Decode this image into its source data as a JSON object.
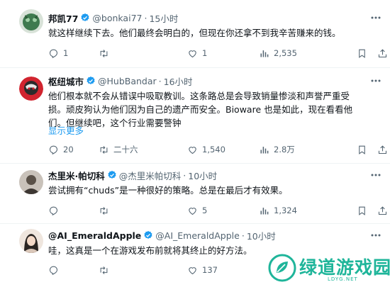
{
  "tweets": [
    {
      "name": "邦凯77",
      "handle": "@bonkai77",
      "time": "15小时",
      "text": [
        "就这样继续下去。他们最终会明白的，但现在你还拿不到我辛苦赚来的钱。"
      ],
      "show_more": "",
      "replies": "1",
      "retweets": "",
      "likes": "1",
      "views": "2,535",
      "avatar_color": "#3f7a4f"
    },
    {
      "name": "枢纽城市",
      "handle": "@HubBandar",
      "time": "16小时",
      "text": [
        "他们根本就不会从错误中吸取教训。这条路总是会导致销量惨淡和声誉严重受",
        "损。顽皮狗认为他们因为自己的遗产而安全。Bioware 也是如此，现在看看他",
        "们。但继续吧，这个行业需要警钟"
      ],
      "show_more": "显示更多",
      "replies": "20",
      "retweets": "二十六",
      "likes": "1,540",
      "views": "2.8万",
      "avatar_color": "#d1242f"
    },
    {
      "name": "杰里米·帕切科",
      "handle": "@杰里米帕切科",
      "time": "10小时",
      "text": [
        "尝试拥有“chuds”是一种很好的策略。总是在最后才有效果。"
      ],
      "show_more": "",
      "replies": "",
      "retweets": "",
      "likes": "5",
      "views": "1,324",
      "avatar_color": "#5a5148"
    },
    {
      "name": "@AI_EmeraldApple",
      "handle": "@AI_EmeraldApple",
      "time": "10小时",
      "text": [
        "哇，这真是一个在游戏发布前就将其终止的好方法。"
      ],
      "show_more": "",
      "replies": "",
      "retweets": "",
      "likes": "137",
      "views": "",
      "avatar_color": "#d9c6b8"
    }
  ],
  "watermark": {
    "title": "绿道游戏园",
    "sub": "LDYG.NET",
    "color": "#1fb59a"
  },
  "icons": {
    "reply": "reply-icon",
    "retweet": "retweet-icon",
    "like": "heart-icon",
    "views": "views-bar-icon",
    "bookmark": "bookmark-icon",
    "share": "share-icon",
    "verified": "verified-badge-icon",
    "more": "more-icon"
  },
  "colors": {
    "text": "#0f1419",
    "muted": "#536471",
    "link": "#1d9bf0",
    "verified": "#1d9bf0",
    "divider": "#eff3f4"
  }
}
